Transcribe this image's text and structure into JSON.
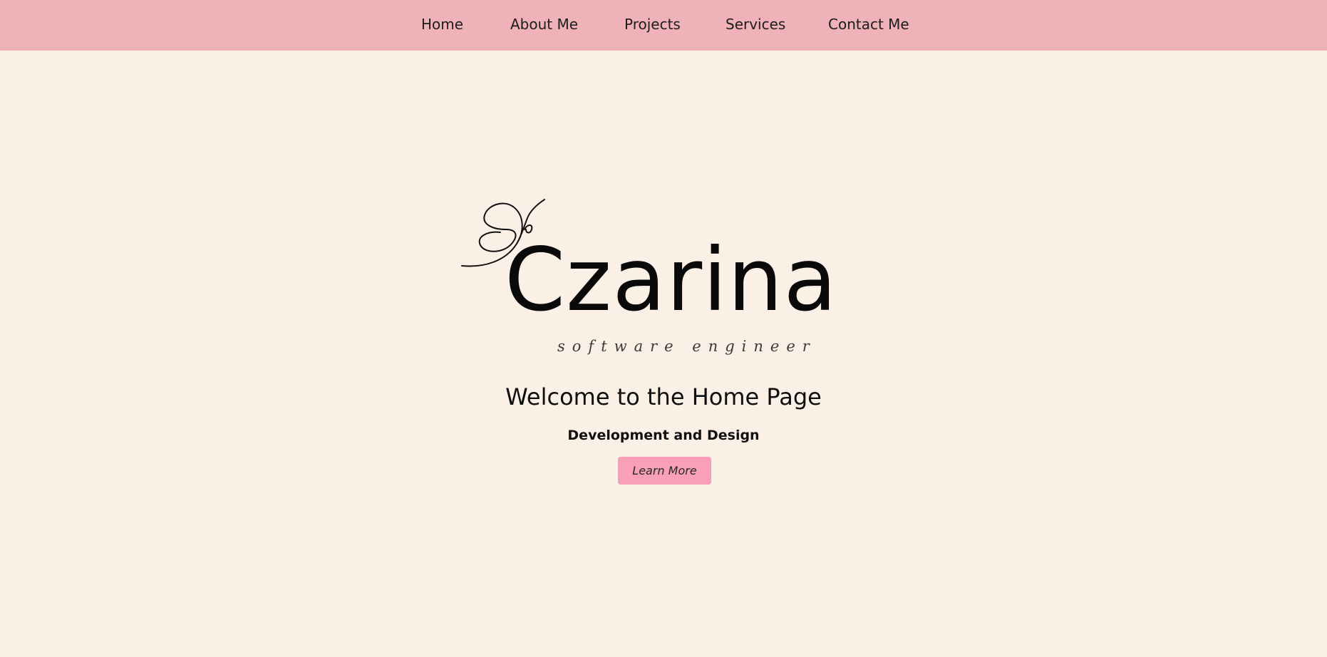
{
  "nav": {
    "items": [
      {
        "label": "Home"
      },
      {
        "label": "About Me"
      },
      {
        "label": "Projects"
      },
      {
        "label": "Services"
      },
      {
        "label": "Contact Me"
      }
    ]
  },
  "logo": {
    "name": "Czarina",
    "tagline": "software engineer",
    "icon": "butterfly-icon"
  },
  "hero": {
    "title": "Welcome to the Home Page",
    "subtitle": "Development and Design",
    "button_label": "Learn More"
  },
  "colors": {
    "nav_background": "#f0b2b9",
    "page_background": "#faf0e6",
    "button_background": "#f99fb8",
    "text": "#0f0f0f"
  }
}
